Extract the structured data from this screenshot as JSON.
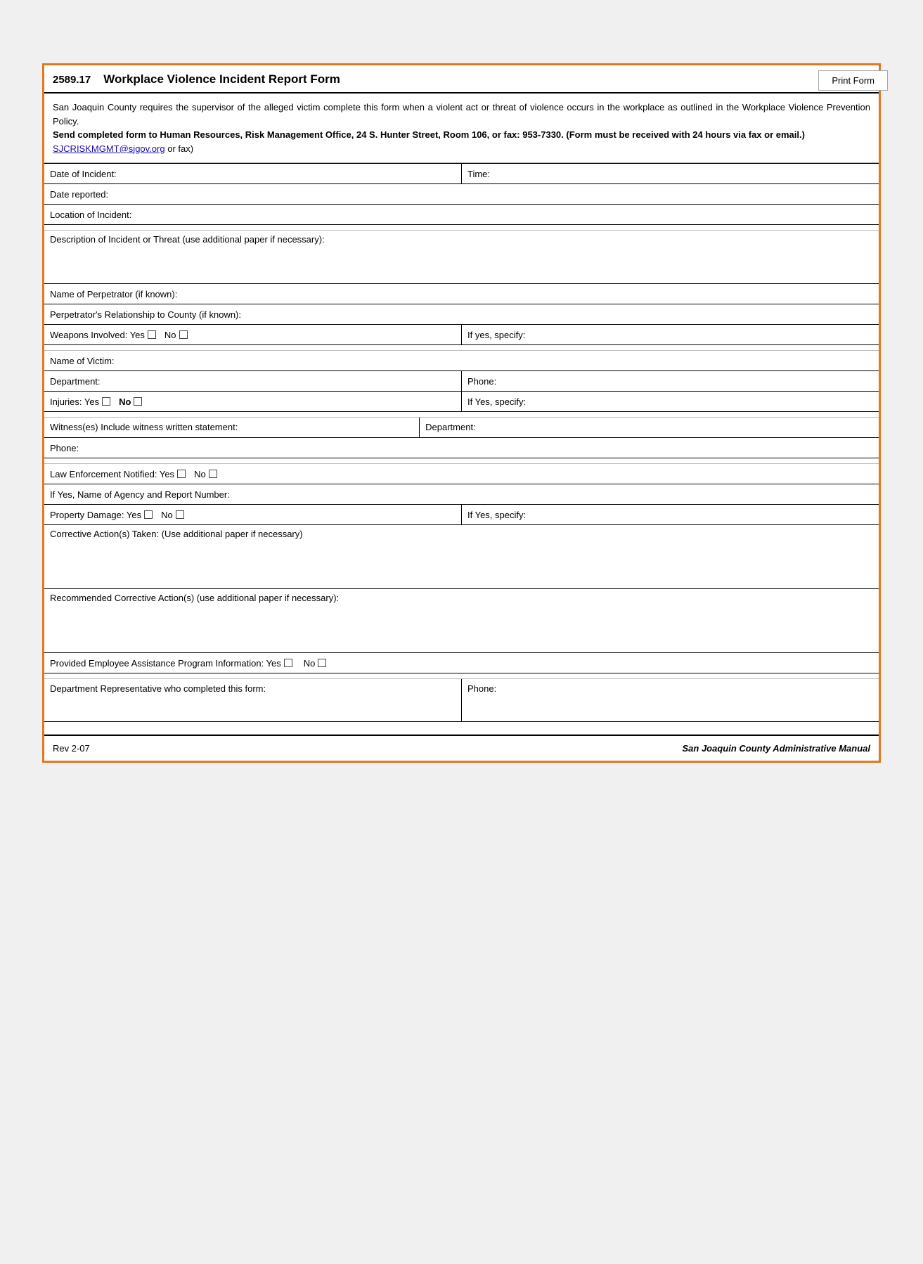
{
  "page": {
    "background_color": "#f0f0f0",
    "border_color": "#e07820"
  },
  "print_button": {
    "label": "Print Form"
  },
  "form": {
    "number": "2589.17",
    "title": "Workplace Violence Incident Report Form",
    "intro_text": "San Joaquin County requires the supervisor of the alleged victim complete this form when a violent act or threat of violence occurs in the workplace as outlined in the Workplace Violence Prevention Policy.",
    "bold_text": "Send completed form to Human Resources, Risk Management Office, 24 S. Hunter Street, Room 106, or fax:  953-7330.  (Form must be received with 24 hours via fax or email.)",
    "email_text": "SJCRISKMGMT@sjgov.org",
    "email_suffix": " or fax)",
    "fields": {
      "date_of_incident_label": "Date of Incident:",
      "time_label": "Time:",
      "date_reported_label": "Date reported:",
      "location_label": "Location of Incident:",
      "description_label": "Description of Incident or Threat (use additional paper if necessary):",
      "perpetrator_name_label": "Name of Perpetrator (if known):",
      "perpetrator_relationship_label": "Perpetrator's Relationship to County (if known):",
      "weapons_label": "Weapons Involved: Yes",
      "weapons_no_label": "No",
      "weapons_specify_label": "If yes, specify:",
      "victim_name_label": "Name of Victim:",
      "department_label": "Department:",
      "phone_label": "Phone:",
      "injuries_label": "Injuries: Yes",
      "injuries_no_label": "No",
      "injuries_specify_label": "If Yes, specify:",
      "witnesses_label": "Witness(es) Include witness written statement:",
      "witness_dept_label": "Department:",
      "witness_phone_label": "Phone:",
      "law_enforcement_label": "Law Enforcement Notified: Yes",
      "law_enforcement_no_label": "No",
      "agency_report_label": "If Yes, Name of Agency and Report Number:",
      "property_damage_label": "Property Damage: Yes",
      "property_damage_no_label": "No",
      "property_damage_specify_label": "If Yes, specify:",
      "corrective_label": "Corrective Action(s) Taken: (Use additional paper if necessary)",
      "recommended_label": "Recommended Corrective Action(s) (use additional paper if necessary):",
      "employee_assistance_label": "Provided Employee Assistance Program Information:   Yes",
      "employee_assistance_no_label": "No",
      "dept_rep_label": "Department Representative who completed this form:",
      "dept_rep_phone_label": "Phone:"
    },
    "footer": {
      "rev": "Rev 2-07",
      "manual": "San Joaquin County Administrative Manual"
    }
  }
}
